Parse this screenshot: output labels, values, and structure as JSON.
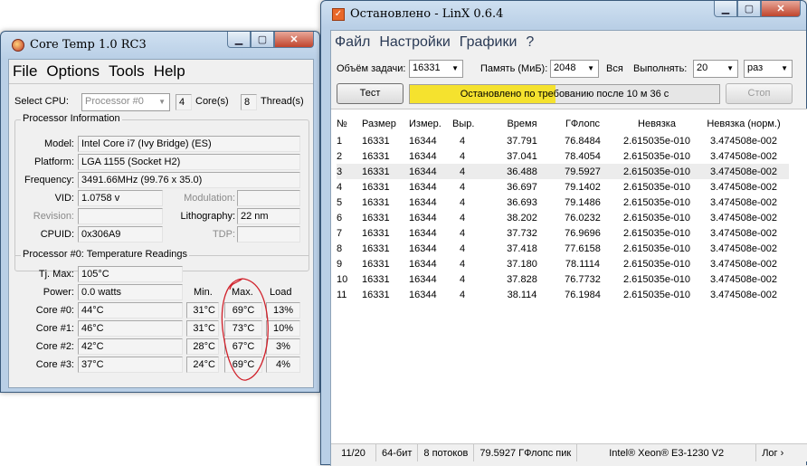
{
  "coretemp": {
    "title": "Core Temp 1.0 RC3",
    "menu": [
      "File",
      "Options",
      "Tools",
      "Help"
    ],
    "select_cpu_label": "Select CPU:",
    "select_cpu_value": "Processor #0",
    "cores_value": "4",
    "cores_label": "Core(s)",
    "threads_value": "8",
    "threads_label": "Thread(s)",
    "proc_info": {
      "caption": "Processor Information",
      "model_label": "Model:",
      "model_value": "Intel Core i7 (Ivy Bridge)  (ES)",
      "platform_label": "Platform:",
      "platform_value": "LGA 1155 (Socket H2)",
      "frequency_label": "Frequency:",
      "frequency_value": "3491.66MHz (99.76 x 35.0)",
      "vid_label": "VID:",
      "vid_value": "1.0758 v",
      "modulation_label": "Modulation:",
      "modulation_value": "",
      "revision_label": "Revision:",
      "revision_value": "",
      "lithography_label": "Lithography:",
      "lithography_value": "22 nm",
      "cpuid_label": "CPUID:",
      "cpuid_value": "0x306A9",
      "tdp_label": "TDP:",
      "tdp_value": ""
    },
    "temps": {
      "caption": "Processor #0: Temperature Readings",
      "tjmax_label": "Tj. Max:",
      "tjmax_value": "105°C",
      "power_label": "Power:",
      "power_value": "0.0 watts",
      "min_header": "Min.",
      "max_header": "Max.",
      "load_header": "Load",
      "cores": [
        {
          "label": "Core #0:",
          "temp": "44°C",
          "min": "31°C",
          "max": "69°C",
          "load": "13%"
        },
        {
          "label": "Core #1:",
          "temp": "46°C",
          "min": "31°C",
          "max": "73°C",
          "load": "10%"
        },
        {
          "label": "Core #2:",
          "temp": "42°C",
          "min": "28°C",
          "max": "67°C",
          "load": "3%"
        },
        {
          "label": "Core #3:",
          "temp": "37°C",
          "min": "24°C",
          "max": "69°C",
          "load": "4%"
        }
      ]
    }
  },
  "linx": {
    "title": "Остановлено - LinX 0.6.4",
    "menu": [
      "Файл",
      "Настройки",
      "Графики",
      "?"
    ],
    "size_label": "Объём задачи:",
    "size_value": "16331",
    "memory_label": "Память (МиБ):",
    "memory_value": "2048",
    "all_label": "Вся",
    "run_label": "Выполнять:",
    "run_value": "20",
    "times_value": "раз",
    "test_button": "Тест",
    "progress_text": "Остановлено по требованию после 10 м 36 с",
    "progress_fraction": 0.47,
    "stop_button": "Стоп",
    "columns": [
      "№",
      "Размер",
      "Измер.",
      "Выр.",
      "Время",
      "ГФлопс",
      "Невязка",
      "Невязка (норм.)"
    ],
    "rows": [
      [
        "1",
        "16331",
        "16344",
        "4",
        "37.791",
        "76.8484",
        "2.615035e-010",
        "3.474508e-002"
      ],
      [
        "2",
        "16331",
        "16344",
        "4",
        "37.041",
        "78.4054",
        "2.615035e-010",
        "3.474508e-002"
      ],
      [
        "3",
        "16331",
        "16344",
        "4",
        "36.488",
        "79.5927",
        "2.615035e-010",
        "3.474508e-002"
      ],
      [
        "4",
        "16331",
        "16344",
        "4",
        "36.697",
        "79.1402",
        "2.615035e-010",
        "3.474508e-002"
      ],
      [
        "5",
        "16331",
        "16344",
        "4",
        "36.693",
        "79.1486",
        "2.615035e-010",
        "3.474508e-002"
      ],
      [
        "6",
        "16331",
        "16344",
        "4",
        "38.202",
        "76.0232",
        "2.615035e-010",
        "3.474508e-002"
      ],
      [
        "7",
        "16331",
        "16344",
        "4",
        "37.732",
        "76.9696",
        "2.615035e-010",
        "3.474508e-002"
      ],
      [
        "8",
        "16331",
        "16344",
        "4",
        "37.418",
        "77.6158",
        "2.615035e-010",
        "3.474508e-002"
      ],
      [
        "9",
        "16331",
        "16344",
        "4",
        "37.180",
        "78.1114",
        "2.615035e-010",
        "3.474508e-002"
      ],
      [
        "10",
        "16331",
        "16344",
        "4",
        "37.828",
        "76.7732",
        "2.615035e-010",
        "3.474508e-002"
      ],
      [
        "11",
        "16331",
        "16344",
        "4",
        "38.114",
        "76.1984",
        "2.615035e-010",
        "3.474508e-002"
      ]
    ],
    "status": {
      "progress": "11/20",
      "bits": "64-бит",
      "threads": "8 потоков",
      "peak": "79.5927 ГФлопс пик",
      "cpu": "Intel® Xeon® E3-1230 V2",
      "log": "Лог ›"
    }
  },
  "colors": {
    "progress_fill": "#f5e22e",
    "annotation": "#d0202a"
  }
}
